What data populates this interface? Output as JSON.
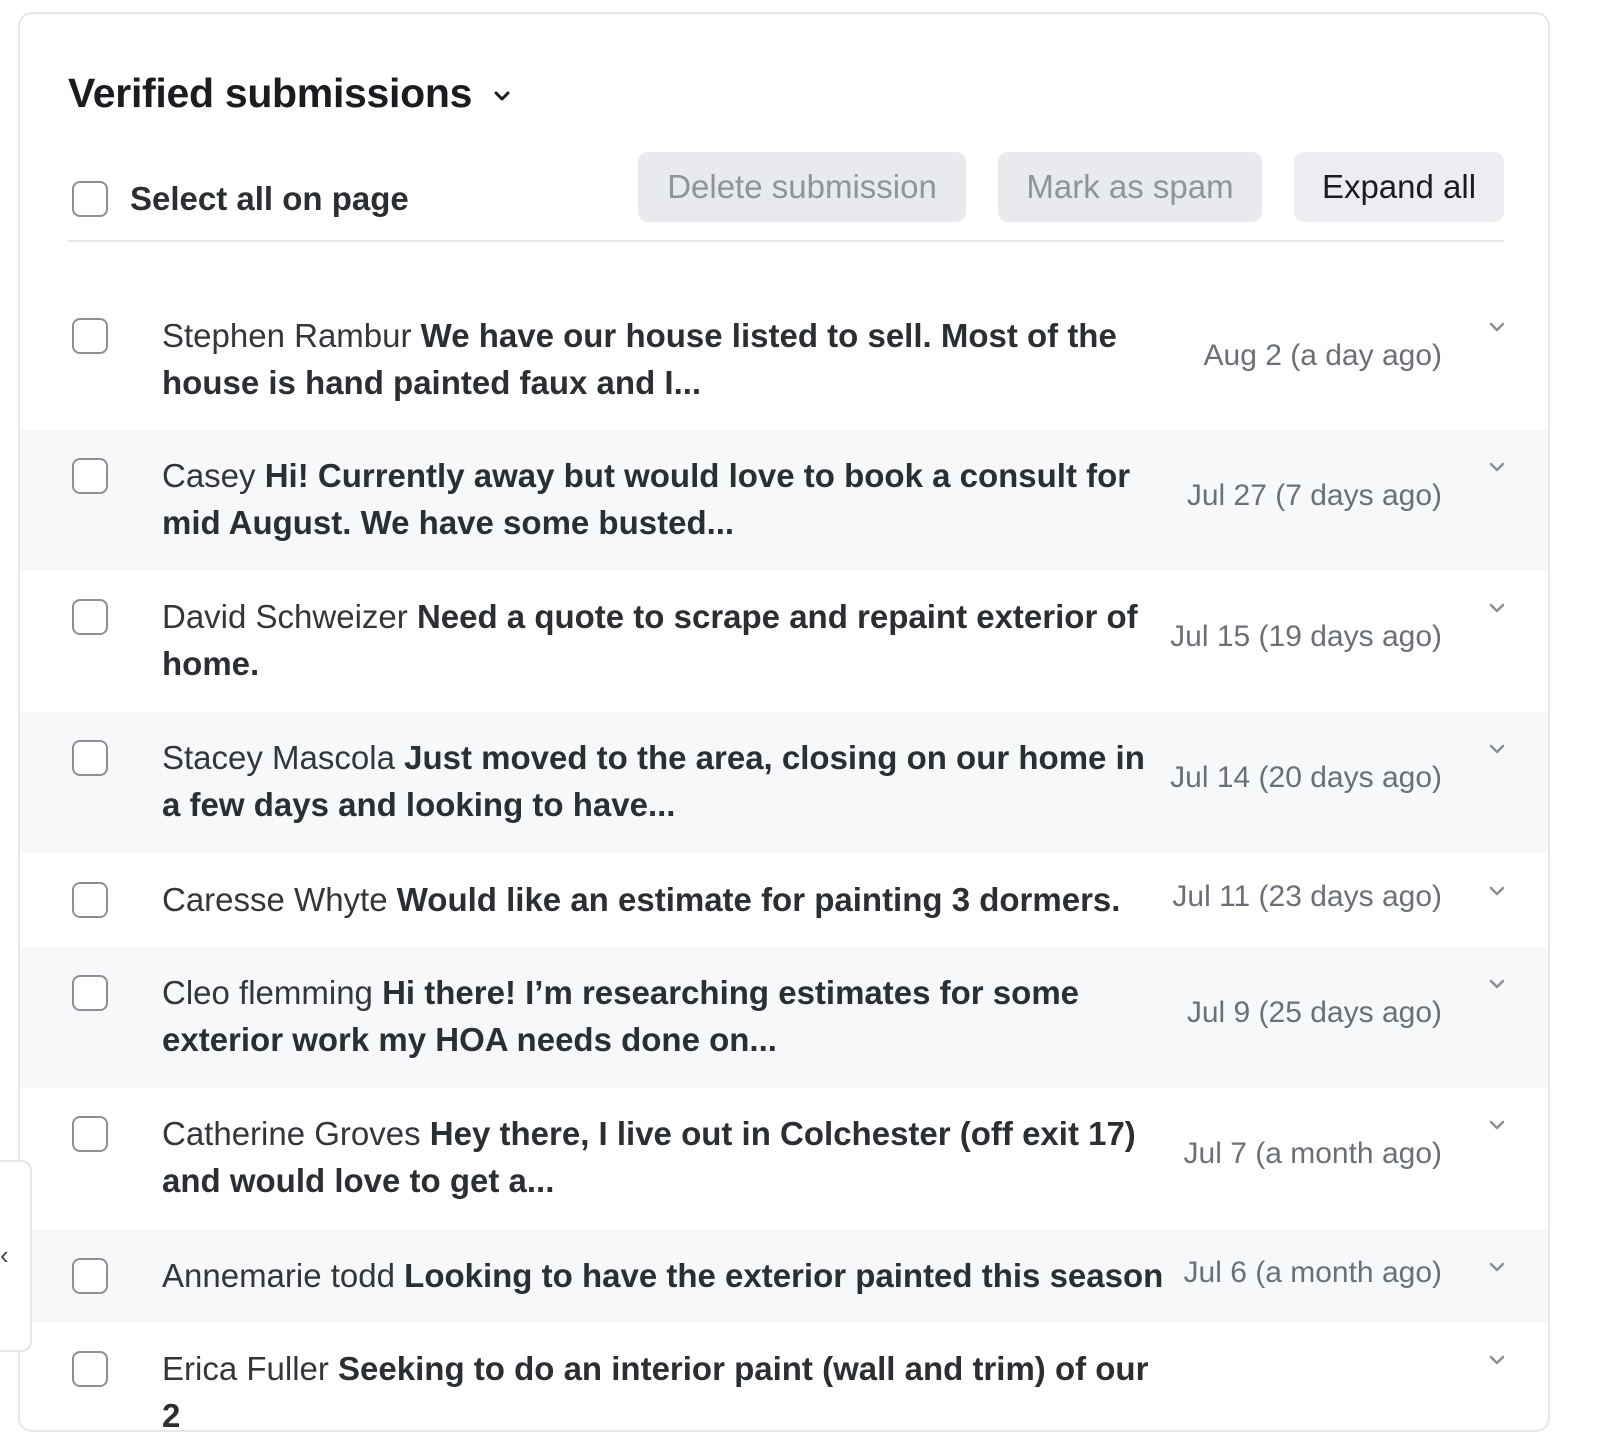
{
  "header": {
    "title": "Verified submissions"
  },
  "toolbar": {
    "select_all_label": "Select all on page",
    "delete_label": "Delete submission",
    "spam_label": "Mark as spam",
    "expand_label": "Expand all"
  },
  "side_tab": {
    "glyph": "‹"
  },
  "submissions": [
    {
      "name": "Stephen Rambur",
      "message": "We have our house listed to sell. Most of the house is hand painted faux and I...",
      "date": "Aug 2 (a day ago)"
    },
    {
      "name": "Casey",
      "message": "Hi! Currently away but would love to book a consult for mid August. We have some busted...",
      "date": "Jul 27 (7 days ago)"
    },
    {
      "name": "David Schweizer",
      "message": "Need a quote to scrape and repaint exterior of home.",
      "date": "Jul 15 (19 days ago)"
    },
    {
      "name": "Stacey Mascola",
      "message": "Just moved to the area, closing on our home in a few days and looking to have...",
      "date": "Jul 14 (20 days ago)"
    },
    {
      "name": "Caresse Whyte",
      "message": "Would like an estimate for painting 3 dormers.",
      "date": "Jul 11 (23 days ago)"
    },
    {
      "name": "Cleo flemming",
      "message": "Hi there! I’m researching estimates for some exterior work my HOA needs done on...",
      "date": "Jul 9 (25 days ago)"
    },
    {
      "name": "Catherine Groves",
      "message": "Hey there, I live out in Colchester (off exit 17) and would love to get a...",
      "date": "Jul 7 (a month ago)"
    },
    {
      "name": "Annemarie todd",
      "message": "Looking to have the exterior painted this season",
      "date": "Jul 6 (a month ago)"
    },
    {
      "name": "Erica Fuller",
      "message": "Seeking to do an interior paint (wall and trim) of our 2",
      "date": ""
    }
  ]
}
